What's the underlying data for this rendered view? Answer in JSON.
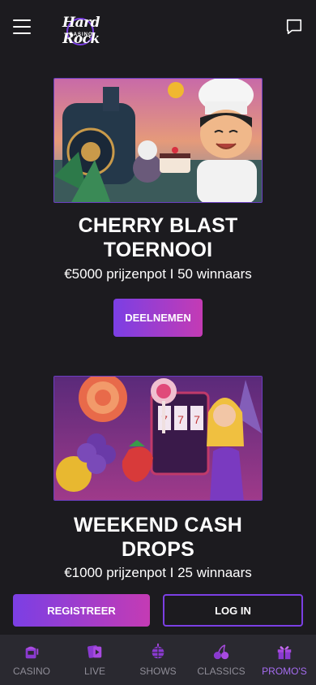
{
  "header": {
    "logo_text": "Hard Rock",
    "logo_sub": "CASINO"
  },
  "promos": [
    {
      "title_line1": "CHERRY BLAST",
      "title_line2": "TOERNOOI",
      "subtitle": "€5000 prijzenpot I 50 winnaars",
      "button_label": "DEELNEMEN"
    },
    {
      "title_line1": "WEEKEND CASH",
      "title_line2": "DROPS",
      "subtitle": "€1000 prijzenpot I 25 winnaars"
    }
  ],
  "auth": {
    "register_label": "REGISTREER",
    "login_label": "LOG IN"
  },
  "tabbar": {
    "items": [
      {
        "label": "CASINO",
        "icon": "slot-machine-icon"
      },
      {
        "label": "LIVE",
        "icon": "live-cards-icon"
      },
      {
        "label": "SHOWS",
        "icon": "disco-ball-icon"
      },
      {
        "label": "CLASSICS",
        "icon": "cherries-icon"
      },
      {
        "label": "PROMO'S",
        "icon": "gift-icon"
      }
    ],
    "active": "PROMO'S"
  },
  "colors": {
    "background": "#1c1b1f",
    "accent_purple": "#7b3fe4",
    "accent_magenta": "#c43bb4",
    "tabbar_bg": "#2a2930",
    "tab_inactive": "#8e8c96",
    "tab_active": "#a56cf0"
  }
}
